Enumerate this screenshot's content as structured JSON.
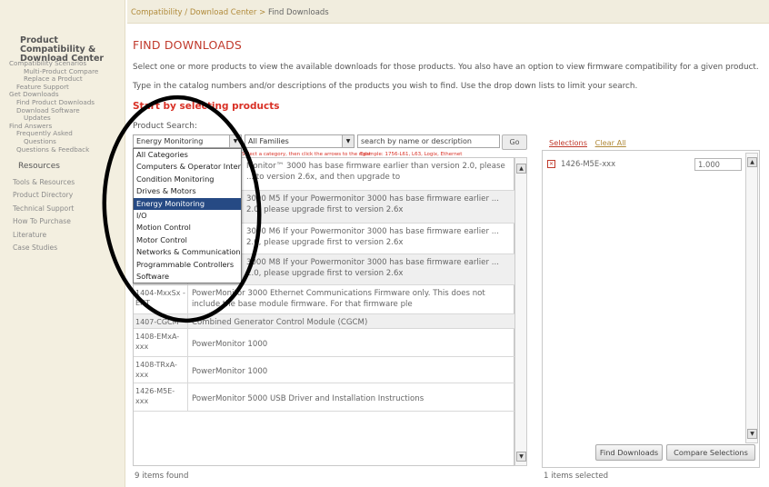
{
  "sidebar": {
    "title": "Product Compatibility & Download Center",
    "items": [
      "Compatibility Scenarios",
      "Multi-Product Compare",
      "Replace a Product",
      "Feature Support",
      "Get Downloads",
      "Find Product Downloads",
      "Download Software",
      "Updates",
      "Find Answers",
      "Frequently Asked",
      "Questions",
      "Questions & Feedback"
    ],
    "resources_heading": "Resources",
    "links": [
      "Tools & Resources",
      "Product Directory",
      "Technical Support",
      "How To Purchase",
      "Literature",
      "Case Studies"
    ]
  },
  "breadcrumb": {
    "part1": "Compatibility",
    "sep1": " / ",
    "part2": "Download Center",
    "sep2": " > ",
    "current": "Find Downloads"
  },
  "page": {
    "title": "FIND DOWNLOADS",
    "intro1": "Select one or more products to view the available downloads for those products. You also have an option to view firmware compatibility for a given product.",
    "intro2": "Type in the catalog numbers and/or descriptions of the products you wish to find. Use the drop down lists to limit your search.",
    "start_heading": "Start by selecting products",
    "product_search_label": "Product Search:"
  },
  "search": {
    "category_value": "Energy Monitoring",
    "family_value": "All Families",
    "text_placeholder": "search by name or description",
    "go_label": "Go",
    "category_hint": "Select a category, then click the arrows to the right",
    "example_hint": "Example: 1756-L61, L63, Logix, Ethernet"
  },
  "dropdown_options": [
    "All Categories",
    "Computers & Operator Interface",
    "Condition Monitoring",
    "Drives & Motors",
    "Energy Monitoring",
    "I/O",
    "Motion Control",
    "Motor Control",
    "Networks & Communications",
    "Programmable Controllers",
    "Software"
  ],
  "dropdown_selected_index": 4,
  "results": [
    {
      "cat": "",
      "desc": "Monitor™ 3000 has base firmware earlier than version 2.0, please ... to version 2.6x, and then upgrade to"
    },
    {
      "cat": "",
      "desc": "3000 M5 If your Powermonitor 3000 has base firmware earlier ... 2.0, please upgrade first to version 2.6x"
    },
    {
      "cat": "",
      "desc": "3000 M6 If your Powermonitor 3000 has base firmware earlier ... 2.0, please upgrade first to version 2.6x"
    },
    {
      "cat": "",
      "desc": "3000 M8 If your Powermonitor 3000 has base firmware earlier ... 2.0, please upgrade first to version 2.6x"
    },
    {
      "cat": "1404-MxxSx -ENT",
      "desc": "PowerMonitor 3000 Ethernet Communications Firmware only. This does not include the base module firmware. For that firmware ple"
    },
    {
      "cat": "1407-CGCM",
      "desc": "Combined Generator Control Module (CGCM)"
    },
    {
      "cat": "1408-EMxA- xxx",
      "desc": "PowerMonitor 1000"
    },
    {
      "cat": "1408-TRxA- xxx",
      "desc": "PowerMonitor 1000"
    },
    {
      "cat": "1426-M5E- xxx",
      "desc": "PowerMonitor 5000 USB Driver and Installation Instructions"
    }
  ],
  "items_found": "9 items found",
  "selections": {
    "tab_label": "Selections",
    "clear_label": "Clear All",
    "items": [
      {
        "name": "1426-M5E-xxx",
        "qty": "1.000"
      }
    ],
    "find_button": "Find Downloads",
    "compare_button": "Compare Selections",
    "items_selected": "1 items selected"
  },
  "colors": {
    "accent_red": "#c0392b",
    "highlight_blue": "#264a84",
    "sidebar_bg": "#f3efe0"
  },
  "icons": {
    "dropdown_arrow": "triangle-down",
    "scroll_up": "triangle-up",
    "scroll_down": "triangle-down",
    "remove": "x-box"
  }
}
